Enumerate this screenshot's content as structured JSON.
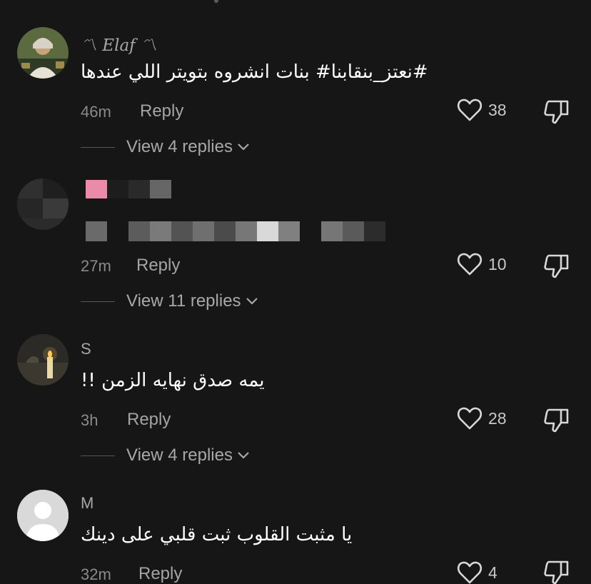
{
  "comments": [
    {
      "username": "〽 Elaf 〽",
      "text": "#نعتز_بنقابنا# بنات انشروه بتويتر اللي عندها",
      "time": "46m",
      "reply": "Reply",
      "likes": "38",
      "view_replies": "View 4 replies"
    },
    {
      "username": "",
      "text": "",
      "time": "27m",
      "reply": "Reply",
      "likes": "10",
      "view_replies": "View 11 replies"
    },
    {
      "username": "S",
      "text": "يمه صدق نهايه الزمن !!",
      "time": "3h",
      "reply": "Reply",
      "likes": "28",
      "view_replies": "View 4 replies"
    },
    {
      "username": "M",
      "text": "يا مثبت القلوب ثبت قلبي على دينك",
      "time": "32m",
      "reply": "Reply",
      "likes": "4"
    }
  ],
  "icons": {
    "like": "heart-outline-icon",
    "dislike": "thumbs-down-icon",
    "expand": "chevron-down-icon"
  },
  "colors": {
    "background": "#161616",
    "pixelated_pink": "#ec8aa9"
  }
}
